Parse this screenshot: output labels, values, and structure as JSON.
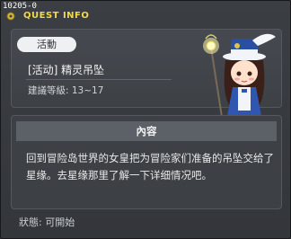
{
  "window": {
    "quest_id": "10205-0",
    "title": "QUEST INFO"
  },
  "quest": {
    "tag": "活動",
    "name": "[活动] 精灵吊坠",
    "level": "建議等級: 13~17"
  },
  "content": {
    "header": "內容",
    "text": "回到冒险岛世界的女皇把为冒险家们准备的吊坠交给了星缘。去星缘那里了解一下详细情况吧。"
  },
  "status": {
    "text": "狀態:  可開始"
  },
  "colors": {
    "title": "#f2d84a",
    "panel": "#3d4146",
    "header": "#5c6167"
  },
  "icons": {
    "title_icon": "gear-cog-icon",
    "npc": "npc-girl-with-staff"
  }
}
